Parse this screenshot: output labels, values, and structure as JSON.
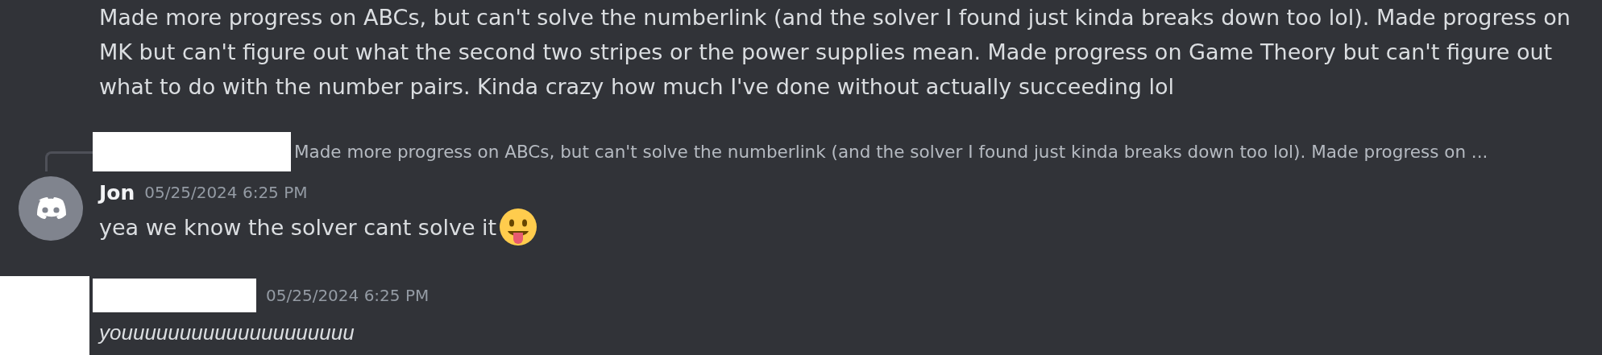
{
  "messages": [
    {
      "kind": "continuation",
      "text": "Made more progress on ABCs, but can't solve the numberlink (and the solver I found just kinda breaks down too lol). Made progress on MK but can't figure out what the second two stripes or the power supplies mean. Made progress on Game Theory but can't figure out what to do with the number pairs. Kinda crazy how much I've done without actually succeeding lol"
    },
    {
      "kind": "reply",
      "reply_author_redacted": true,
      "reply_preview": "Made more progress on ABCs, but can't solve the numberlink (and the solver I found just kinda breaks down too lol). Made progress on ...",
      "author": "Jon",
      "timestamp": "05/25/2024 6:25 PM",
      "text": "yea we know the solver cant solve it",
      "emoji": true
    },
    {
      "kind": "message",
      "author_redacted": true,
      "timestamp": "05/25/2024 6:25 PM",
      "text": "youuuuuuuuuuuuuuuuuuuu",
      "italic": true
    }
  ]
}
